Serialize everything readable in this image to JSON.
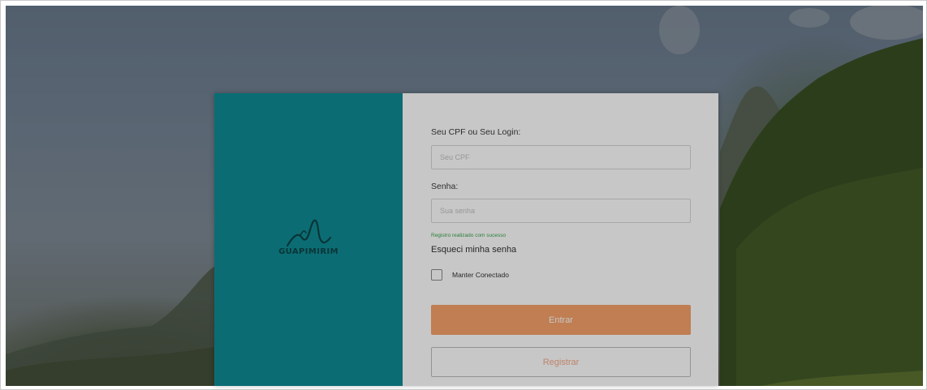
{
  "colors": {
    "brand_teal": "#0f8c94",
    "primary_orange": "#f7a26a",
    "secondary_text_orange": "#f4a989",
    "hint_green": "#3aa54a"
  },
  "brand": {
    "logo_icon": "mountain-logo-icon",
    "logo_text": "GUAPIMIRIM"
  },
  "login_form": {
    "cpf_label": "Seu CPF ou Seu Login:",
    "cpf_placeholder": "Seu CPF",
    "cpf_value": "",
    "password_label": "Senha:",
    "password_placeholder": "Sua senha",
    "password_value": "",
    "hint_text": "Registro realizado com sucesso",
    "forgot_password": "Esqueci minha senha",
    "remember_me": "Manter Conectado",
    "remember_checked": false,
    "submit_label": "Entrar",
    "register_label": "Registrar"
  }
}
